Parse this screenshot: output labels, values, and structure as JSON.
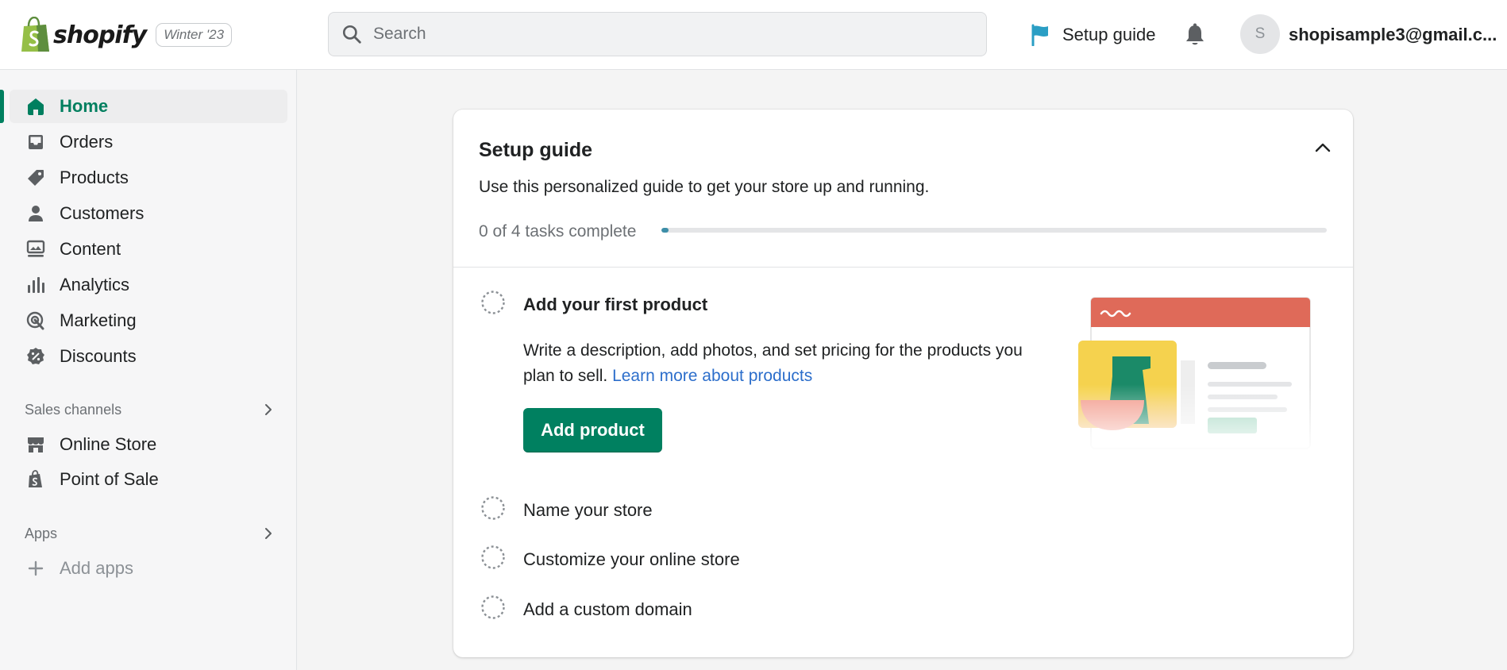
{
  "topbar": {
    "logo_text": "shopify",
    "version_badge": "Winter '23",
    "search_placeholder": "Search",
    "setup_guide_label": "Setup guide",
    "avatar_initial": "S",
    "account_email": "shopisample3@gmail.c..."
  },
  "sidebar": {
    "items": [
      {
        "label": "Home",
        "icon": "home-icon",
        "active": true
      },
      {
        "label": "Orders",
        "icon": "inbox-icon"
      },
      {
        "label": "Products",
        "icon": "tag-icon"
      },
      {
        "label": "Customers",
        "icon": "person-icon"
      },
      {
        "label": "Content",
        "icon": "image-icon"
      },
      {
        "label": "Analytics",
        "icon": "bar-chart-icon"
      },
      {
        "label": "Marketing",
        "icon": "target-icon"
      },
      {
        "label": "Discounts",
        "icon": "discount-icon"
      }
    ],
    "sales_channels_label": "Sales channels",
    "sales_channels": [
      {
        "label": "Online Store",
        "icon": "store-icon"
      },
      {
        "label": "Point of Sale",
        "icon": "pos-icon"
      }
    ],
    "apps_label": "Apps",
    "add_apps_label": "Add apps"
  },
  "setup_guide": {
    "title": "Setup guide",
    "subtitle": "Use this personalized guide to get your store up and running.",
    "progress_text": "0 of 4 tasks complete",
    "progress_fraction": 0,
    "tasks": [
      {
        "label": "Add your first product",
        "description": "Write a description, add photos, and set pricing for the products you plan to sell.",
        "link_text": "Learn more about products",
        "button_label": "Add product",
        "expanded": true
      },
      {
        "label": "Name your store"
      },
      {
        "label": "Customize your online store"
      },
      {
        "label": "Add a custom domain"
      }
    ]
  },
  "colors": {
    "accent": "#008060",
    "active_text": "#007f5f",
    "link": "#2c6ecb",
    "flag": "#2a9ec4",
    "illustration_header": "#df6a59",
    "illustration_yellow": "#f5d24e"
  }
}
